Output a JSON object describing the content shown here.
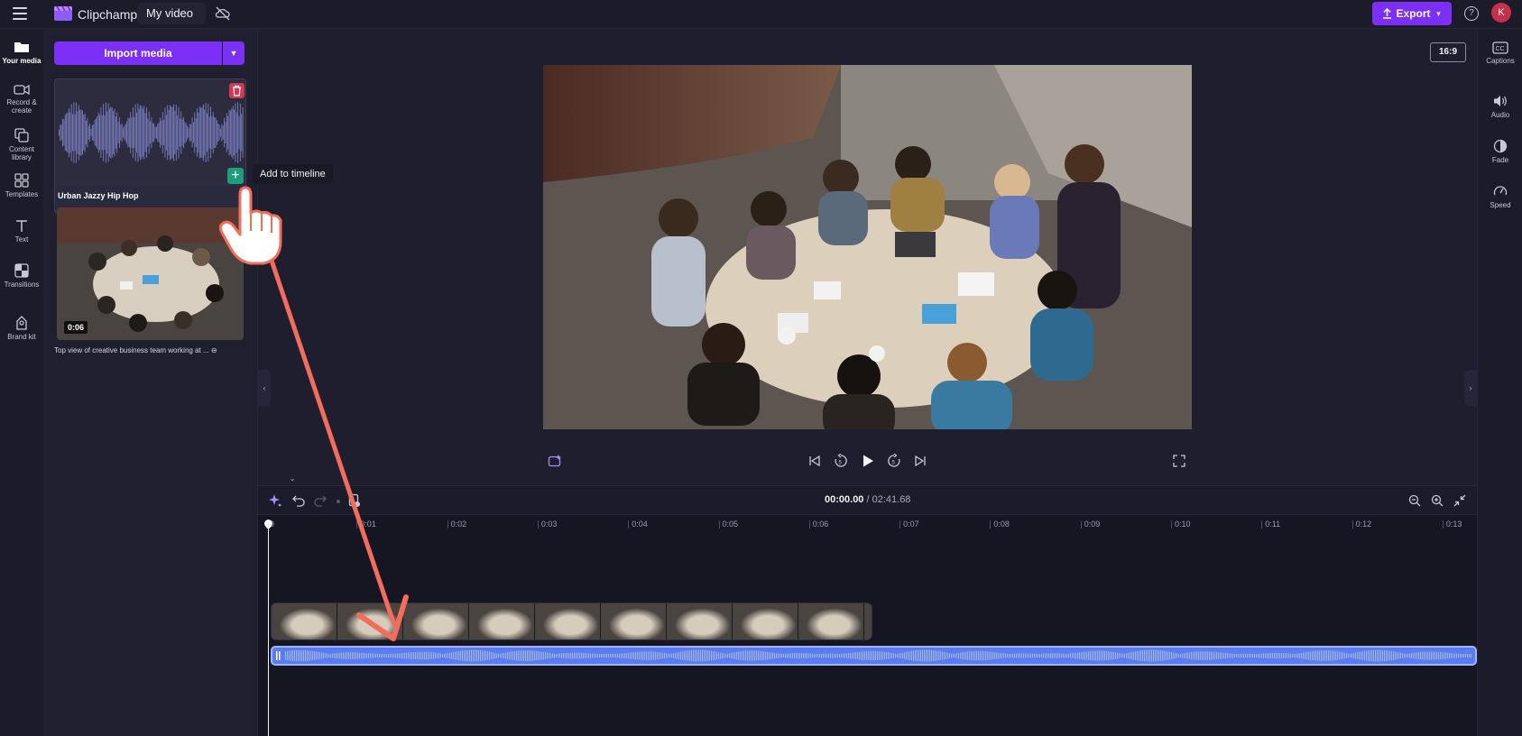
{
  "topbar": {
    "app_name": "Clipchamp",
    "video_title": "My video",
    "export_label": "Export",
    "avatar_initial": "K",
    "help_glyph": "?"
  },
  "left_rail": {
    "items": [
      {
        "label_lines": [
          "Your media"
        ],
        "icon": "folder-icon",
        "active": true
      },
      {
        "label_lines": [
          "Record &",
          "create"
        ],
        "icon": "camera-icon",
        "active": false
      },
      {
        "label_lines": [
          "Content",
          "library"
        ],
        "icon": "library-icon",
        "active": false
      },
      {
        "label_lines": [
          "Templates"
        ],
        "icon": "templates-icon",
        "active": false
      },
      {
        "label_lines": [
          "Text"
        ],
        "icon": "text-icon",
        "active": false
      },
      {
        "label_lines": [
          "Transitions"
        ],
        "icon": "transitions-icon",
        "active": false
      },
      {
        "label_lines": [
          "Brand kit"
        ],
        "icon": "brand-kit-icon",
        "active": false
      }
    ]
  },
  "media_panel": {
    "import_label": "Import media",
    "audio_item": {
      "name": "Urban Jazzy Hip Hop"
    },
    "video_item": {
      "duration": "0:06",
      "caption": "Top view of creative business team working at ..."
    },
    "tooltip": "Add to timeline"
  },
  "preview": {
    "aspect_ratio": "16:9"
  },
  "right_rail": {
    "items": [
      {
        "label": "Captions",
        "icon": "captions-icon"
      },
      {
        "label": "Audio",
        "icon": "speaker-icon"
      },
      {
        "label": "Fade",
        "icon": "fade-icon"
      },
      {
        "label": "Speed",
        "icon": "speedometer-icon"
      }
    ]
  },
  "timeline": {
    "current_time": "00:00.00",
    "separator": " / ",
    "total_time": "02:41.68",
    "ruler_labels": [
      "0",
      "0:01",
      "0:02",
      "0:03",
      "0:04",
      "0:05",
      "0:06",
      "0:07",
      "0:08",
      "0:09",
      "0:10",
      "0:11",
      "0:12",
      "0:13"
    ],
    "playhead_fraction": 0
  },
  "colors": {
    "accent": "#7b2ff7",
    "add_button": "#1f9c7a",
    "delete_button": "#d13a50",
    "audio_track": "#5b7bf0",
    "annotation_arrow": "#f26d5b",
    "avatar": "#c4314b"
  }
}
